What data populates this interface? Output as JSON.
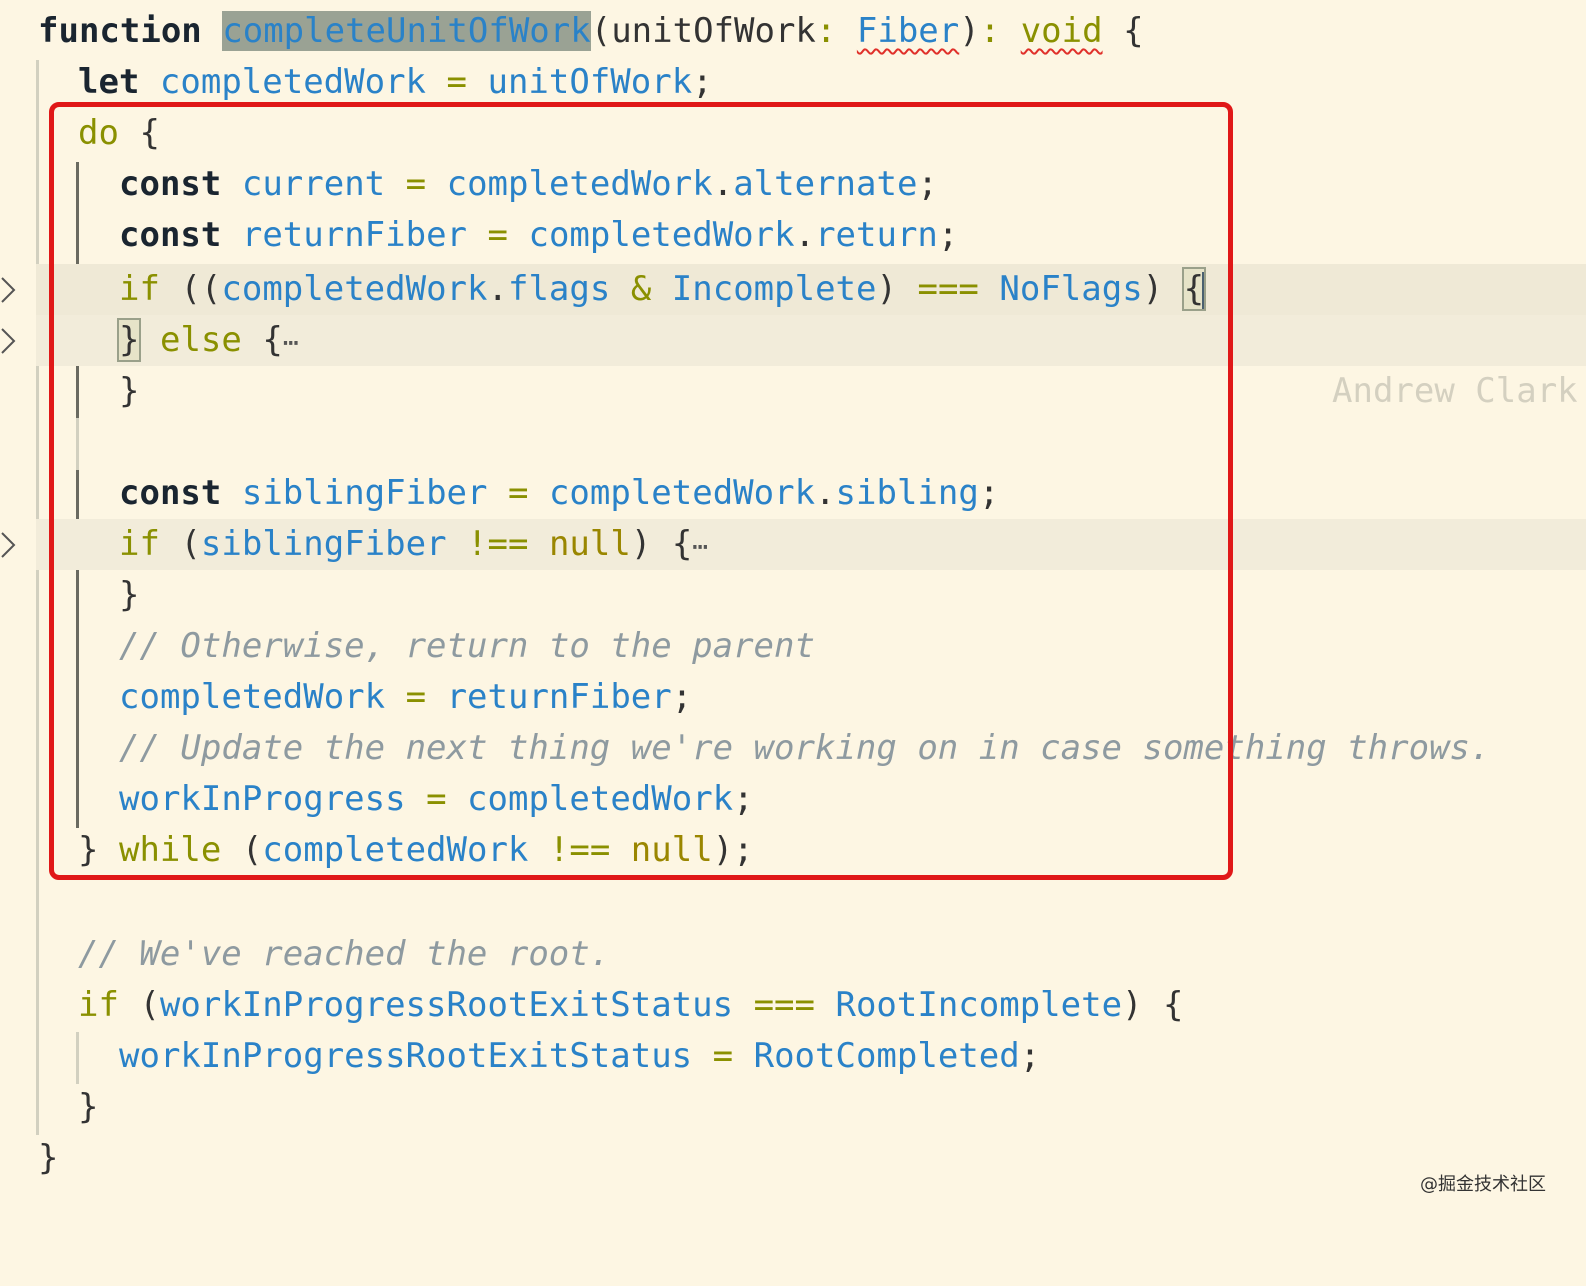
{
  "editor": {
    "l1": {
      "kw": "function",
      "name": "completeUnitOfWork",
      "p1": "(",
      "param": "unitOfWork",
      "colon": ":",
      "type": "Fiber",
      "p2": ")",
      "colon2": ":",
      "ret": "void",
      "brace": "{"
    },
    "l2": {
      "kw": "let",
      "var": "completedWork",
      "eq": "=",
      "val": "unitOfWork",
      "semi": ";"
    },
    "l3": {
      "kw": "do",
      "brace": "{"
    },
    "l4": {
      "kw": "const",
      "var": "current",
      "eq": "=",
      "obj": "completedWork",
      "dot": ".",
      "prop": "alternate",
      "semi": ";"
    },
    "l5": {
      "kw": "const",
      "var": "returnFiber",
      "eq": "=",
      "obj": "completedWork",
      "dot": ".",
      "prop": "return",
      "semi": ";"
    },
    "l6": {
      "kw": "if",
      "p1": "((",
      "obj": "completedWork",
      "dot": ".",
      "prop": "flags",
      "amp": "&",
      "flag": "Incomplete",
      "p2": ")",
      "op": "===",
      "flag2": "NoFlags",
      "p3": ")",
      "brace": "{",
      "blame": "Andrew Clark"
    },
    "l7": {
      "brace": "}",
      "kw": "else",
      "brace2": "{",
      "ellipsis": "⋯"
    },
    "l8": {
      "brace": "}"
    },
    "l10": {
      "kw": "const",
      "var": "siblingFiber",
      "eq": "=",
      "obj": "completedWork",
      "dot": ".",
      "prop": "sibling",
      "semi": ";"
    },
    "l11": {
      "kw": "if",
      "p1": "(",
      "var": "siblingFiber",
      "op": "!==",
      "nul": "null",
      "p2": ")",
      "brace": "{",
      "ellipsis": "⋯"
    },
    "l12": {
      "brace": "}"
    },
    "l13": {
      "comment": "// Otherwise, return to the parent"
    },
    "l14": {
      "var": "completedWork",
      "eq": "=",
      "val": "returnFiber",
      "semi": ";"
    },
    "l15": {
      "comment": "// Update the next thing we're working on in case something throws."
    },
    "l16": {
      "var": "workInProgress",
      "eq": "=",
      "val": "completedWork",
      "semi": ";"
    },
    "l17": {
      "brace": "}",
      "kw": "while",
      "p1": "(",
      "var": "completedWork",
      "op": "!==",
      "nul": "null",
      "p2": ");"
    },
    "l19": {
      "comment": "// We've reached the root."
    },
    "l20": {
      "kw": "if",
      "p1": "(",
      "var": "workInProgressRootExitStatus",
      "op": "===",
      "val": "RootIncomplete",
      "p2": ")",
      "brace": "{"
    },
    "l21": {
      "var": "workInProgressRootExitStatus",
      "eq": "=",
      "val": "RootCompleted",
      "semi": ";"
    },
    "l22": {
      "brace": "}"
    },
    "l23": {
      "brace": "}"
    }
  },
  "watermark": "@掘金技术社区",
  "colors": {
    "background": "#fdf6e3",
    "highlight_box": "#e01818",
    "keyword": "#1a2530",
    "control": "#8a9000",
    "identifier": "#2a82c8",
    "comment": "#8e9aa0"
  },
  "icons": {
    "fold": "chevron-right-icon"
  }
}
